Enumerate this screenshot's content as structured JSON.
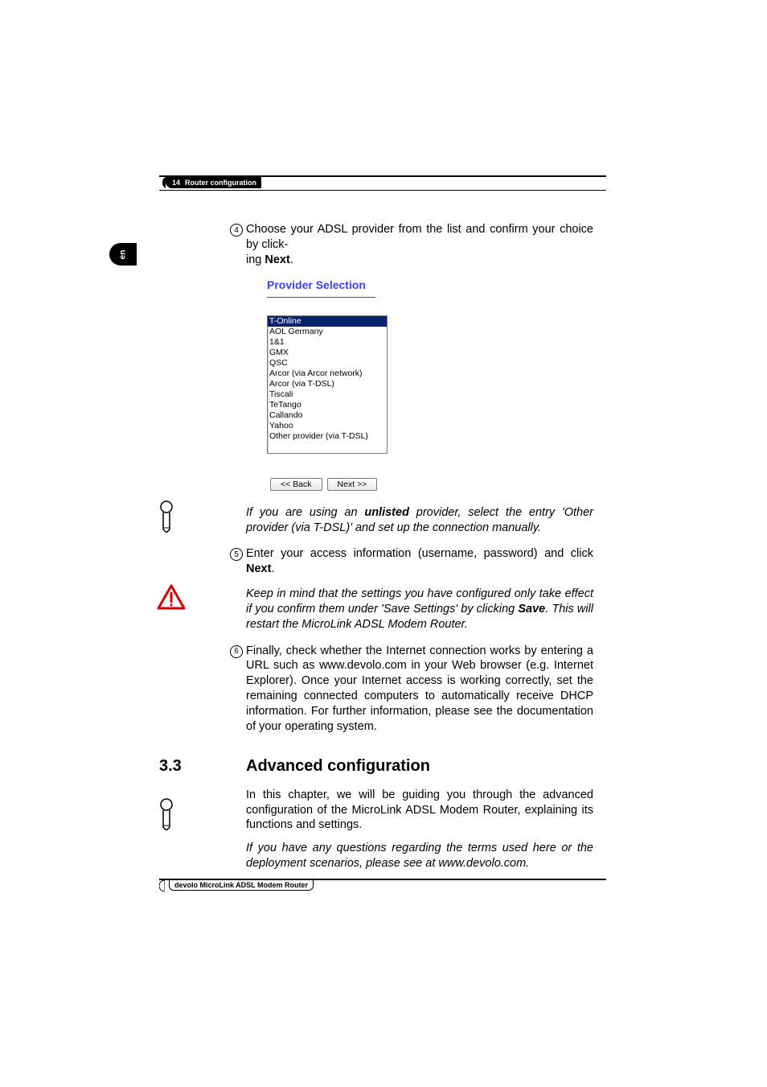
{
  "header": {
    "page_number": "14",
    "chapter_title": "Router configuration"
  },
  "side_tab": {
    "label": "en"
  },
  "steps": {
    "s4": {
      "num": "4",
      "text_a": "Choose your ADSL provider from the list and confirm your choice by click-",
      "text_b": "ing ",
      "bold": "Next",
      "text_c": "."
    },
    "s5": {
      "num": "5",
      "text_a": "Enter your access information (username, password) and click ",
      "bold": "Next",
      "text_b": "."
    },
    "s6": {
      "num": "6",
      "text": "Finally, check whether the Internet connection works by entering a URL such as www.devolo.com in your Web browser (e.g. Internet Explorer). Once your Internet access is working correctly, set the remaining connected computers to automatically receive DHCP information. For further information, please see the documentation of your operating system."
    }
  },
  "provider_selection": {
    "title": "Provider Selection",
    "items": [
      "T-Online",
      "AOL Germany",
      "1&1",
      "GMX",
      "QSC",
      "Arcor (via Arcor network)",
      "Arcor (via T-DSL)",
      "Tiscali",
      "TeTango",
      "Callando",
      "Yahoo",
      "Other provider (via T-DSL)"
    ],
    "back_label": "<< Back",
    "next_label": "Next >>"
  },
  "notes": {
    "unlisted_a": "If you are using an ",
    "unlisted_bold": "unlisted",
    "unlisted_b": " provider, select the entry 'Other provider (via T-DSL)' and set up the connection manually.",
    "save_a": "Keep in mind that the settings you have configured only take effect if you confirm them under 'Save Settings' by clicking ",
    "save_bold": "Save",
    "save_b": ". This will restart the MicroLink ADSL Modem Router.",
    "questions": "If you have any questions regarding the terms used here or the deployment scenarios, please see at www.devolo.com."
  },
  "section": {
    "number": "3.3",
    "title": "Advanced configuration",
    "intro": "In this chapter, we will be guiding you through the advanced configuration of the MicroLink ADSL Modem Router, explaining its functions and settings."
  },
  "footer": {
    "text": "devolo MicroLink ADSL Modem Router"
  }
}
